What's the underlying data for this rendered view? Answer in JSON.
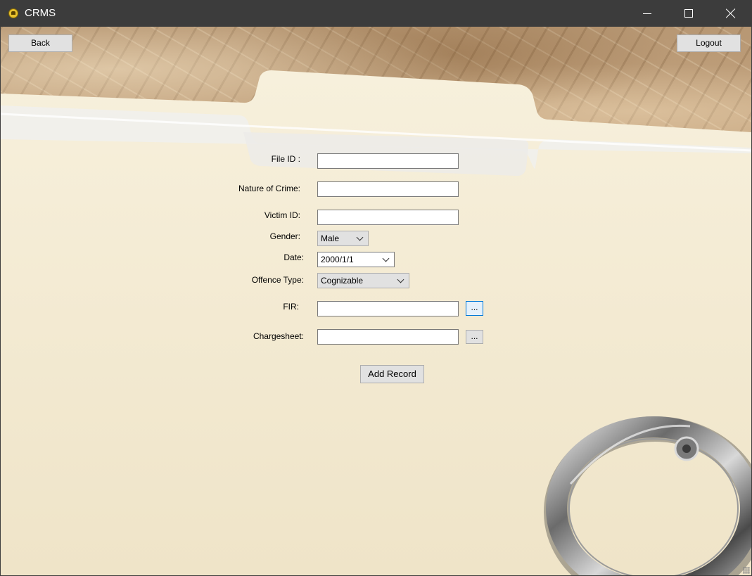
{
  "window": {
    "title": "CRMS",
    "app_icon": "crms-app-icon",
    "controls": [
      "minimize-icon",
      "maximize-icon",
      "close-icon"
    ]
  },
  "nav": {
    "back_label": "Back",
    "logout_label": "Logout"
  },
  "form": {
    "file_id_label": "File ID :",
    "file_id_value": "",
    "nature_label": "Nature of Crime:",
    "nature_value": "",
    "victim_label": "Victim ID:",
    "victim_value": "",
    "gender_label": "Gender:",
    "gender_value": "Male",
    "date_label": "Date:",
    "date_value": "2000/1/1",
    "offence_label": "Offence Type:",
    "offence_value": "Cognizable",
    "fir_label": "FIR:",
    "fir_value": "",
    "fir_browse_label": "...",
    "chargesheet_label": "Chargesheet:",
    "chargesheet_value": "",
    "chargesheet_browse_label": "...",
    "submit_label": "Add Record"
  },
  "colors": {
    "titlebar": "#3c3c3c",
    "folder": "#f3ead3",
    "kraft_paper": "#c2a17c",
    "focus_border": "#0078d7"
  }
}
